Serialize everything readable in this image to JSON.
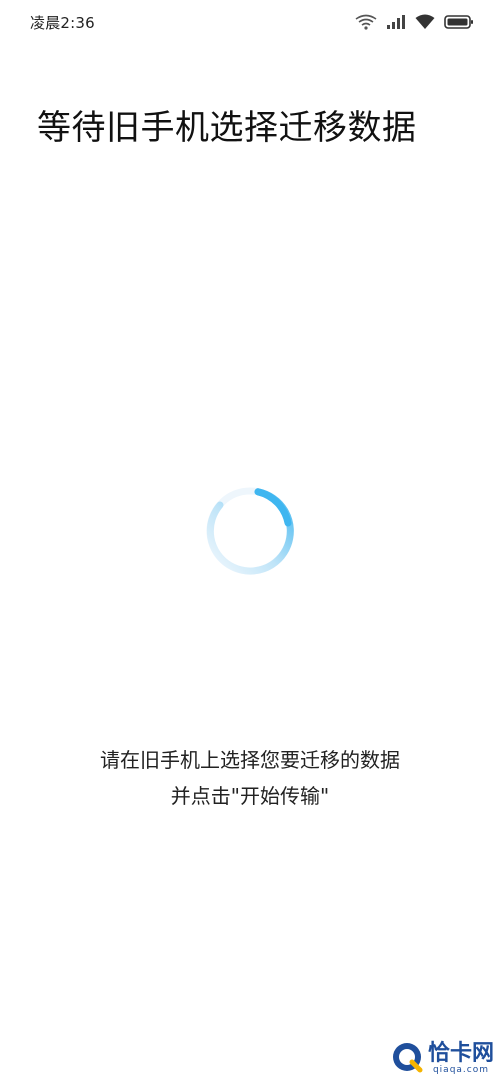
{
  "status_bar": {
    "time": "凌晨2:36",
    "icons": [
      "wifi-signal-icon",
      "cellular-signal-icon",
      "wifi-icon",
      "battery-icon"
    ]
  },
  "title": "等待旧手机选择迁移数据",
  "spinner": {
    "name": "loading-spinner",
    "accent_color": "#3fb6f0",
    "track_color": "#e8f4fc"
  },
  "instruction": {
    "line1": "请在旧手机上选择您要迁移的数据",
    "line2": "并点击\"开始传输\""
  },
  "watermark": {
    "brand": "恰卡网",
    "url": "qiaqa.com"
  }
}
